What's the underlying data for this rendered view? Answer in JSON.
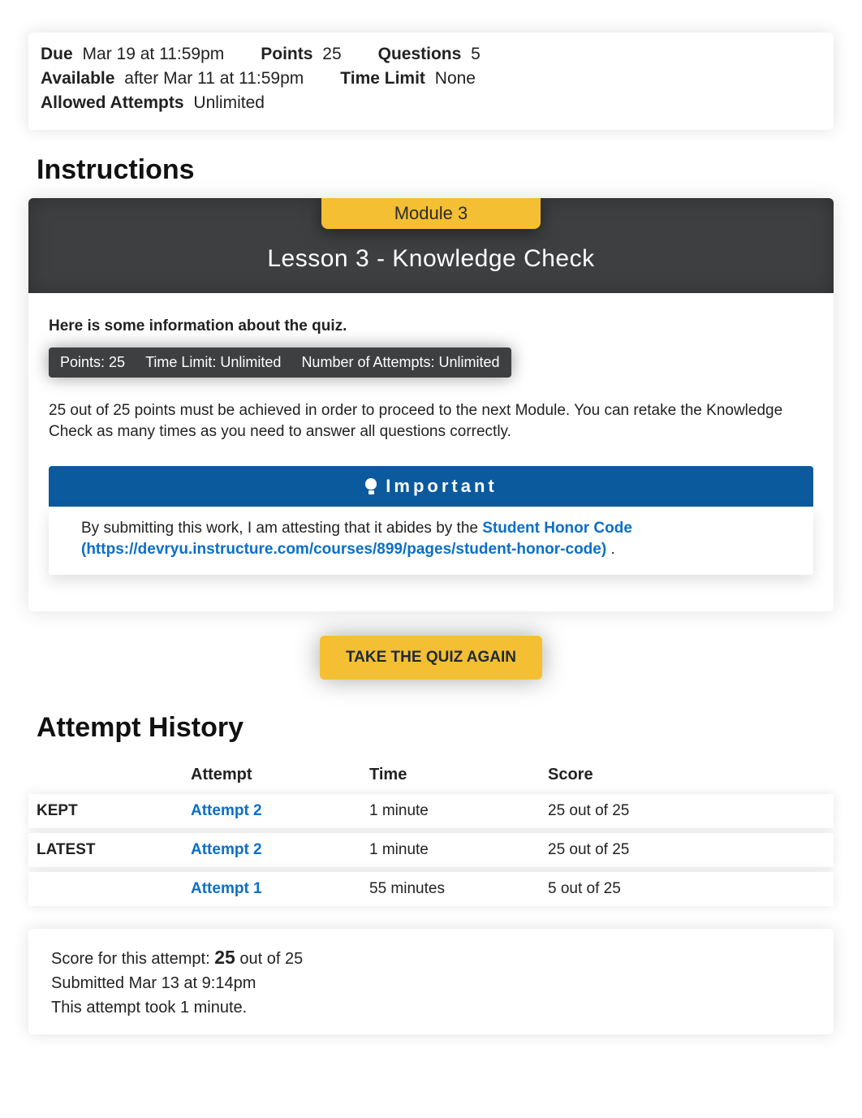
{
  "meta": {
    "due_label": "Due",
    "due_val": "Mar 19 at 11:59pm",
    "points_label": "Points",
    "points_val": "25",
    "questions_label": "Questions",
    "questions_val": "5",
    "available_label": "Available",
    "available_val": "after Mar 11 at 11:59pm",
    "timelimit_label": "Time Limit",
    "timelimit_val": "None",
    "attempts_label": "Allowed Attempts",
    "attempts_val": "Unlimited"
  },
  "instructions_heading": "Instructions",
  "module_label": "Module 3",
  "lesson_title": "Lesson 3 - Knowledge Check",
  "quiz_info_lead": "Here is some information about the quiz.",
  "quiz_info": {
    "points": "Points: 25",
    "timelimit": "Time Limit: Unlimited",
    "attempts": "Number of Attempts: Unlimited"
  },
  "quiz_explain": "25 out of 25 points must be achieved in order to proceed to the next Module. You can retake the Knowledge Check as many times as you need to answer all questions correctly.",
  "important_label": "Important",
  "honor_prefix": "By submitting this work, I am attesting that it abides by the ",
  "honor_link_text": "Student Honor Code (https://devryu.instructure.com/courses/899/pages/student-honor-code)",
  "honor_suffix": " .",
  "take_quiz_label": "TAKE THE QUIZ AGAIN",
  "attempt_history_heading": "Attempt History",
  "history_headers": {
    "c1": "",
    "c2": "Attempt",
    "c3": "Time",
    "c4": "Score"
  },
  "history_rows": [
    {
      "tag": "KEPT",
      "attempt": "Attempt 2",
      "time": "1 minute",
      "score": "25 out of 25"
    },
    {
      "tag": "LATEST",
      "attempt": "Attempt 2",
      "time": "1 minute",
      "score": "25 out of 25"
    },
    {
      "tag": "",
      "attempt": "Attempt 1",
      "time": "55 minutes",
      "score": "5 out of 25"
    }
  ],
  "score_summary": {
    "line1_prefix": "Score for this attempt: ",
    "line1_big": "25",
    "line1_suffix": " out of 25",
    "line2": "Submitted Mar 13 at 9:14pm",
    "line3": "This attempt took 1 minute."
  }
}
